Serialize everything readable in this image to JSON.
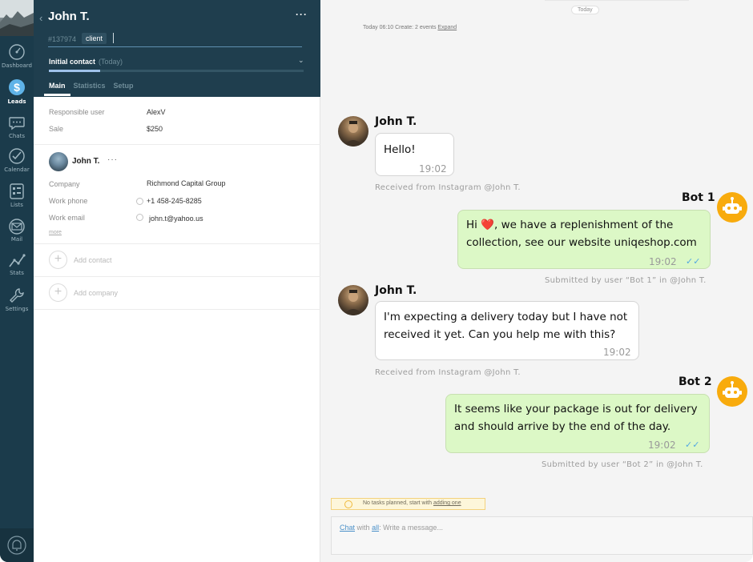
{
  "rail": {
    "items": [
      {
        "label": "Dashboard",
        "icon": "dashboard-icon"
      },
      {
        "label": "Leads",
        "icon": "leads-icon"
      },
      {
        "label": "Chats",
        "icon": "chats-icon"
      },
      {
        "label": "Calendar",
        "icon": "calendar-icon"
      },
      {
        "label": "Lists",
        "icon": "lists-icon"
      },
      {
        "label": "Mail",
        "icon": "mail-icon"
      },
      {
        "label": "Stats",
        "icon": "stats-icon"
      },
      {
        "label": "Settings",
        "icon": "settings-icon"
      }
    ],
    "active": "Leads"
  },
  "lead": {
    "name": "John T.",
    "id": "#137974",
    "tag": "client",
    "stage": "Initial contact",
    "stage_date": "(Today)",
    "stage_progress": 0.2,
    "tabs": [
      "Main",
      "Statistics",
      "Setup"
    ],
    "active_tab": "Main",
    "fields": [
      {
        "label": "Responsible user",
        "value": "AlexV"
      },
      {
        "label": "Sale",
        "value": "$250"
      }
    ]
  },
  "contact": {
    "name": "John T.",
    "fields": [
      {
        "label": "Company",
        "value": "Richmond Capital Group"
      },
      {
        "label": "Work phone",
        "value": "+1 458-245-8285"
      },
      {
        "label": "Work email",
        "value": "john.t@yahoo.us"
      }
    ],
    "more": "more",
    "add_contact": "Add contact",
    "add_company": "Add company"
  },
  "chat": {
    "date_chip": "Today",
    "summary_text": "Today 06:10 Create: 2 events",
    "summary_link": "Expand",
    "messages": [
      {
        "sender": "John T.",
        "text": "Hello!",
        "time": "19:02",
        "meta": "Received from Instagram @John T."
      },
      {
        "sender": "Bot 1",
        "text_line1": "Hi ❤️, we have a replenishment of the",
        "text_line2": "collection, see our website uniqeshop.com",
        "time": "19:02",
        "meta": "Submitted by user “Bot 1” in @John T."
      },
      {
        "sender": "John T.",
        "text_line1": "I'm expecting a delivery today but I have not",
        "text_line2": "received it yet. Can you help me with this?",
        "time": "19:02",
        "meta": "Received from Instagram @John T."
      },
      {
        "sender": "Bot 2",
        "text_line1": "It seems like your package is out for delivery",
        "text_line2": "and should arrive by the end of the day.",
        "time": "19:02",
        "meta": "Submitted by user “Bot 2” in @John T."
      }
    ],
    "tasks_text": "No tasks planned, start with",
    "tasks_link": "adding one",
    "input_chat": "Chat",
    "input_with": "with",
    "input_all": "all",
    "input_placeholder": ": Write a message..."
  },
  "colors": {
    "rail": "#1b3b4b",
    "header": "#1f3e4e",
    "bot_avatar": "#f8ab0d",
    "outgoing_bubble": "#dcf8c6",
    "read_ticks": "#53a8e2"
  }
}
